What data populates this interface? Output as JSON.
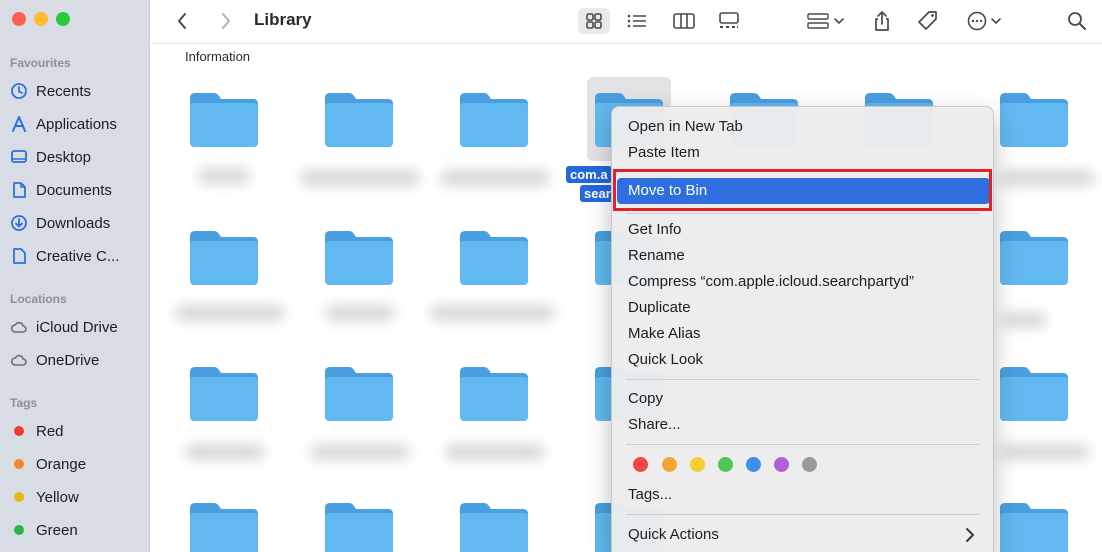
{
  "window": {
    "title": "Library",
    "traffic_lights": [
      "#ff5f57",
      "#febc2e",
      "#28c840"
    ]
  },
  "sidebar": {
    "favourites_header": "Favourites",
    "favourites": [
      {
        "label": "Recents",
        "icon": "clock-icon"
      },
      {
        "label": "Applications",
        "icon": "applications-icon"
      },
      {
        "label": "Desktop",
        "icon": "desktop-icon"
      },
      {
        "label": "Documents",
        "icon": "document-icon"
      },
      {
        "label": "Downloads",
        "icon": "download-icon"
      },
      {
        "label": "Creative C...",
        "icon": "file-icon"
      }
    ],
    "locations_header": "Locations",
    "locations": [
      {
        "label": "iCloud Drive",
        "icon": "cloud-icon"
      },
      {
        "label": "OneDrive",
        "icon": "cloud-icon"
      }
    ],
    "tags_header": "Tags",
    "tags": [
      {
        "label": "Red",
        "color": "#ee3b30"
      },
      {
        "label": "Orange",
        "color": "#f5862a"
      },
      {
        "label": "Yellow",
        "color": "#e9b712"
      },
      {
        "label": "Green",
        "color": "#28b44a"
      }
    ],
    "accent_color": "#2e6edf"
  },
  "content": {
    "section_title": "Information",
    "selected_label_line1": "com.a",
    "selected_label_line2": "sear",
    "folder_color": "#5ab1ee"
  },
  "context_menu": {
    "items_group1": [
      "Open in New Tab",
      "Paste Item"
    ],
    "highlighted": "Move to Bin",
    "items_group2": [
      "Get Info",
      "Rename",
      "Compress “com.apple.icloud.searchpartyd”",
      "Duplicate",
      "Make Alias",
      "Quick Look"
    ],
    "items_group3": [
      "Copy",
      "Share..."
    ],
    "tag_colors": [
      "#ee4a43",
      "#f5a331",
      "#f2cf32",
      "#4ec557",
      "#3e8ef0",
      "#b35ed9",
      "#9a9a9a"
    ],
    "tags_item": "Tags...",
    "quick_actions": "Quick Actions",
    "highlight_color": "#2e6edf",
    "callout_color": "#e0222a"
  }
}
